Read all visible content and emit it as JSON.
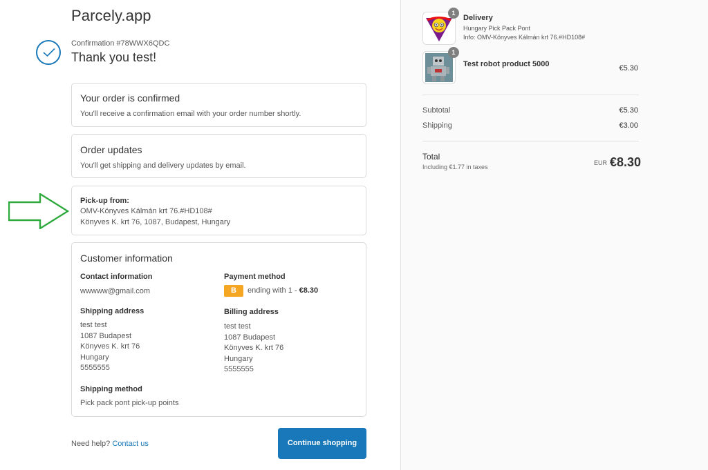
{
  "brand": "Parcely.app",
  "confirmation": {
    "number": "Confirmation #78WWX6QDC",
    "thanks": "Thank you test!"
  },
  "order_confirmed": {
    "title": "Your order is confirmed",
    "text": "You'll receive a confirmation email with your order number shortly."
  },
  "order_updates": {
    "title": "Order updates",
    "text": "You'll get shipping and delivery updates by email."
  },
  "pickup": {
    "label": "Pick-up from:",
    "line1": "OMV-Könyves Kálmán krt 76.#HD108#",
    "line2": "Könyves K. krt 76, 1087, Budapest, Hungary"
  },
  "customer": {
    "title": "Customer information",
    "contact_label": "Contact information",
    "contact_value": "wwwww@gmail.com",
    "payment_label": "Payment method",
    "payment_badge": "B",
    "payment_text": "ending with 1 - ",
    "payment_amount": "€8.30",
    "shipping_address_label": "Shipping address",
    "shipping_address": [
      "test test",
      "1087 Budapest",
      "Könyves K. krt 76",
      "Hungary",
      "5555555"
    ],
    "billing_address_label": "Billing address",
    "billing_address": [
      "test test",
      "1087 Budapest",
      "Könyves K. krt 76",
      "Hungary",
      "5555555"
    ],
    "shipping_method_label": "Shipping method",
    "shipping_method": "Pick pack pont pick-up points"
  },
  "footer": {
    "help_text": "Need help? ",
    "contact_link": "Contact us",
    "continue_button": "Continue shopping"
  },
  "summary": {
    "items": [
      {
        "name": "Delivery",
        "qty": "1",
        "sub1": "Hungary Pick Pack Pont",
        "sub2": "Info: OMV-Könyves Kálmán krt 76.#HD108#",
        "price": "",
        "logo_text": "PICK PACK PONT"
      },
      {
        "name": "Test robot product 5000",
        "qty": "1",
        "price": "€5.30"
      }
    ],
    "subtotal_label": "Subtotal",
    "subtotal_value": "€5.30",
    "shipping_label": "Shipping",
    "shipping_value": "€3.00",
    "total_label": "Total",
    "taxes_note": "Including €1.77 in taxes",
    "currency": "EUR",
    "total_value": "€8.30"
  },
  "colors": {
    "accent": "#1878b9",
    "arrow": "#2eaa3c",
    "payment_badge": "#f5a623"
  }
}
